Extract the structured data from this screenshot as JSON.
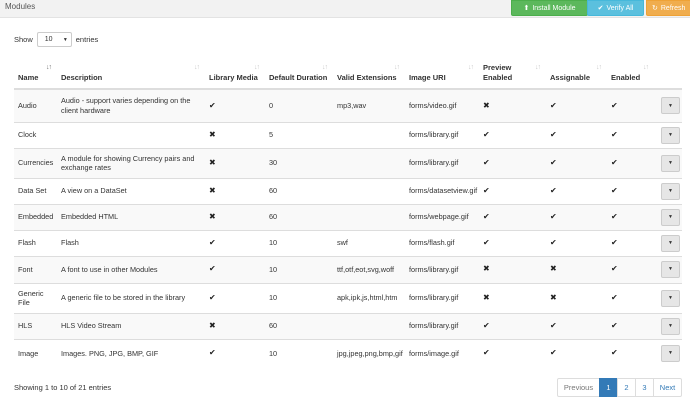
{
  "page": {
    "title": "Modules"
  },
  "toolbar": {
    "install_label": "Install Module",
    "install_icon": "upload-icon",
    "verify_label": "Verify All",
    "verify_icon": "check-circle-icon",
    "refresh_label": "Refresh",
    "refresh_icon": "refresh-icon",
    "colors": {
      "install": "#5cb85c",
      "verify": "#5bc0de",
      "refresh": "#f0ad4e"
    }
  },
  "length": {
    "show_label": "Show",
    "value": "10",
    "entries_label": "entries"
  },
  "table": {
    "columns": [
      "Name",
      "Description",
      "Library Media",
      "Default Duration",
      "Valid Extensions",
      "Image URI",
      "Preview Enabled",
      "Assignable",
      "Enabled"
    ],
    "sorted_column": "Name",
    "sort_direction": "ascending",
    "rows": [
      {
        "name": "Audio",
        "description": "Audio - support varies depending on the client hardware",
        "library_media": true,
        "default_duration": "0",
        "valid_extensions": "mp3,wav",
        "image_uri": "forms/video.gif",
        "preview_enabled": false,
        "assignable": true,
        "enabled": true
      },
      {
        "name": "Clock",
        "description": "",
        "library_media": false,
        "default_duration": "5",
        "valid_extensions": "",
        "image_uri": "forms/library.gif",
        "preview_enabled": true,
        "assignable": true,
        "enabled": true
      },
      {
        "name": "Currencies",
        "description": "A module for showing Currency pairs and exchange rates",
        "library_media": false,
        "default_duration": "30",
        "valid_extensions": "",
        "image_uri": "forms/library.gif",
        "preview_enabled": true,
        "assignable": true,
        "enabled": true
      },
      {
        "name": "Data Set",
        "description": "A view on a DataSet",
        "library_media": false,
        "default_duration": "60",
        "valid_extensions": "",
        "image_uri": "forms/datasetview.gif",
        "preview_enabled": true,
        "assignable": true,
        "enabled": true
      },
      {
        "name": "Embedded",
        "description": "Embedded HTML",
        "library_media": false,
        "default_duration": "60",
        "valid_extensions": "",
        "image_uri": "forms/webpage.gif",
        "preview_enabled": true,
        "assignable": true,
        "enabled": true
      },
      {
        "name": "Flash",
        "description": "Flash",
        "library_media": true,
        "default_duration": "10",
        "valid_extensions": "swf",
        "image_uri": "forms/flash.gif",
        "preview_enabled": true,
        "assignable": true,
        "enabled": true
      },
      {
        "name": "Font",
        "description": "A font to use in other Modules",
        "library_media": true,
        "default_duration": "10",
        "valid_extensions": "ttf,otf,eot,svg,woff",
        "image_uri": "forms/library.gif",
        "preview_enabled": false,
        "assignable": false,
        "enabled": true
      },
      {
        "name": "Generic File",
        "description": "A generic file to be stored in the library",
        "library_media": true,
        "default_duration": "10",
        "valid_extensions": "apk,ipk,js,html,htm",
        "image_uri": "forms/library.gif",
        "preview_enabled": false,
        "assignable": false,
        "enabled": true
      },
      {
        "name": "HLS",
        "description": "HLS Video Stream",
        "library_media": false,
        "default_duration": "60",
        "valid_extensions": "",
        "image_uri": "forms/library.gif",
        "preview_enabled": true,
        "assignable": true,
        "enabled": true
      },
      {
        "name": "Image",
        "description": "Images. PNG, JPG, BMP, GIF",
        "library_media": true,
        "default_duration": "10",
        "valid_extensions": "jpg,jpeg,png,bmp,gif",
        "image_uri": "forms/image.gif",
        "preview_enabled": true,
        "assignable": true,
        "enabled": true
      }
    ]
  },
  "footer": {
    "info": "Showing 1 to 10 of 21 entries"
  },
  "pagination": {
    "previous": "Previous",
    "pages": [
      "1",
      "2",
      "3"
    ],
    "active_page": "1",
    "next": "Next",
    "active_color": "#337ab7"
  }
}
